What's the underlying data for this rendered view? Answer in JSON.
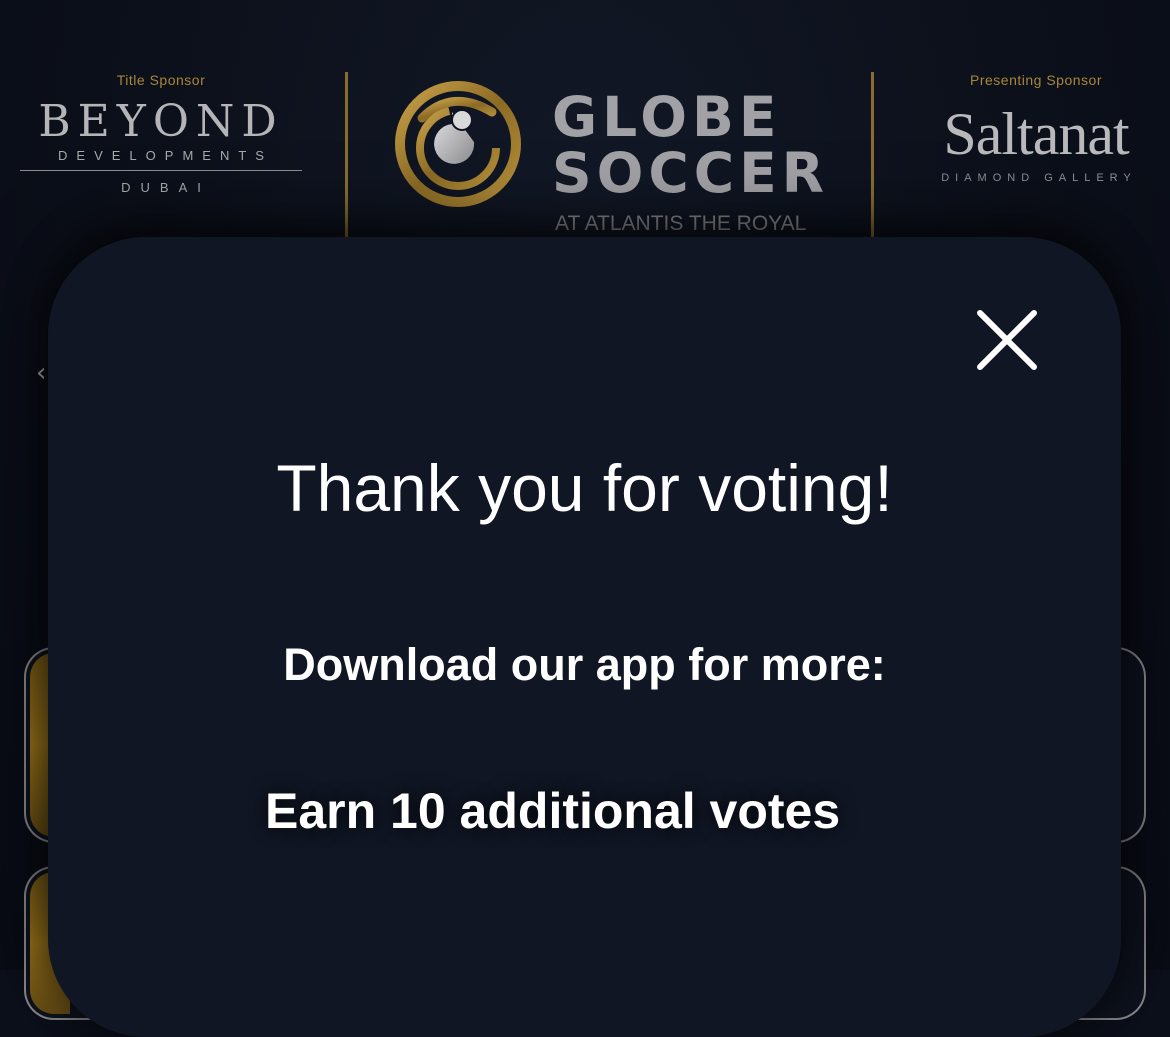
{
  "header": {
    "title_sponsor": {
      "caption": "Title Sponsor",
      "name": "BEYOND",
      "subtitle": "DEVELOPMENTS",
      "city": "DUBAI"
    },
    "main_logo": {
      "line1": "GLOBE",
      "line2": "SOCCER",
      "tagline": "AT ATLANTIS THE ROYAL"
    },
    "presenting_sponsor": {
      "caption": "Presenting Sponsor",
      "name": "Saltanat",
      "subtitle": "DIAMOND GALLERY"
    }
  },
  "nav": {
    "back_glyph": "‹"
  },
  "modal": {
    "title": "Thank you for voting!",
    "subtitle": "Download our app for more:",
    "benefit": "Earn 10 additional votes",
    "close_icon": "close-icon"
  },
  "colors": {
    "background": "#0c101b",
    "modal_bg": "#101624",
    "gold": "#a8863a",
    "text": "#ffffff"
  }
}
